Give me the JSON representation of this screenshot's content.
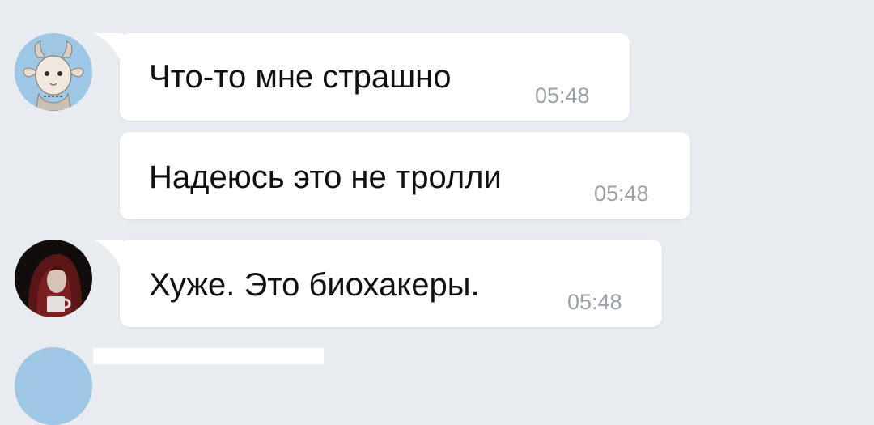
{
  "chat": {
    "messages": [
      {
        "sender_avatar": "goat-character-avatar",
        "text": "Что-то мне страшно",
        "time": "05:48"
      },
      {
        "sender_avatar": null,
        "text": "Надеюсь это не тролли",
        "time": "05:48"
      },
      {
        "sender_avatar": "red-haired-woman-avatar",
        "text": "Хуже. Это биохакеры.",
        "time": "05:48"
      }
    ]
  },
  "colors": {
    "background": "#e8ebf0",
    "bubble": "#ffffff",
    "text": "#111111",
    "timestamp": "#9aa1aa"
  }
}
